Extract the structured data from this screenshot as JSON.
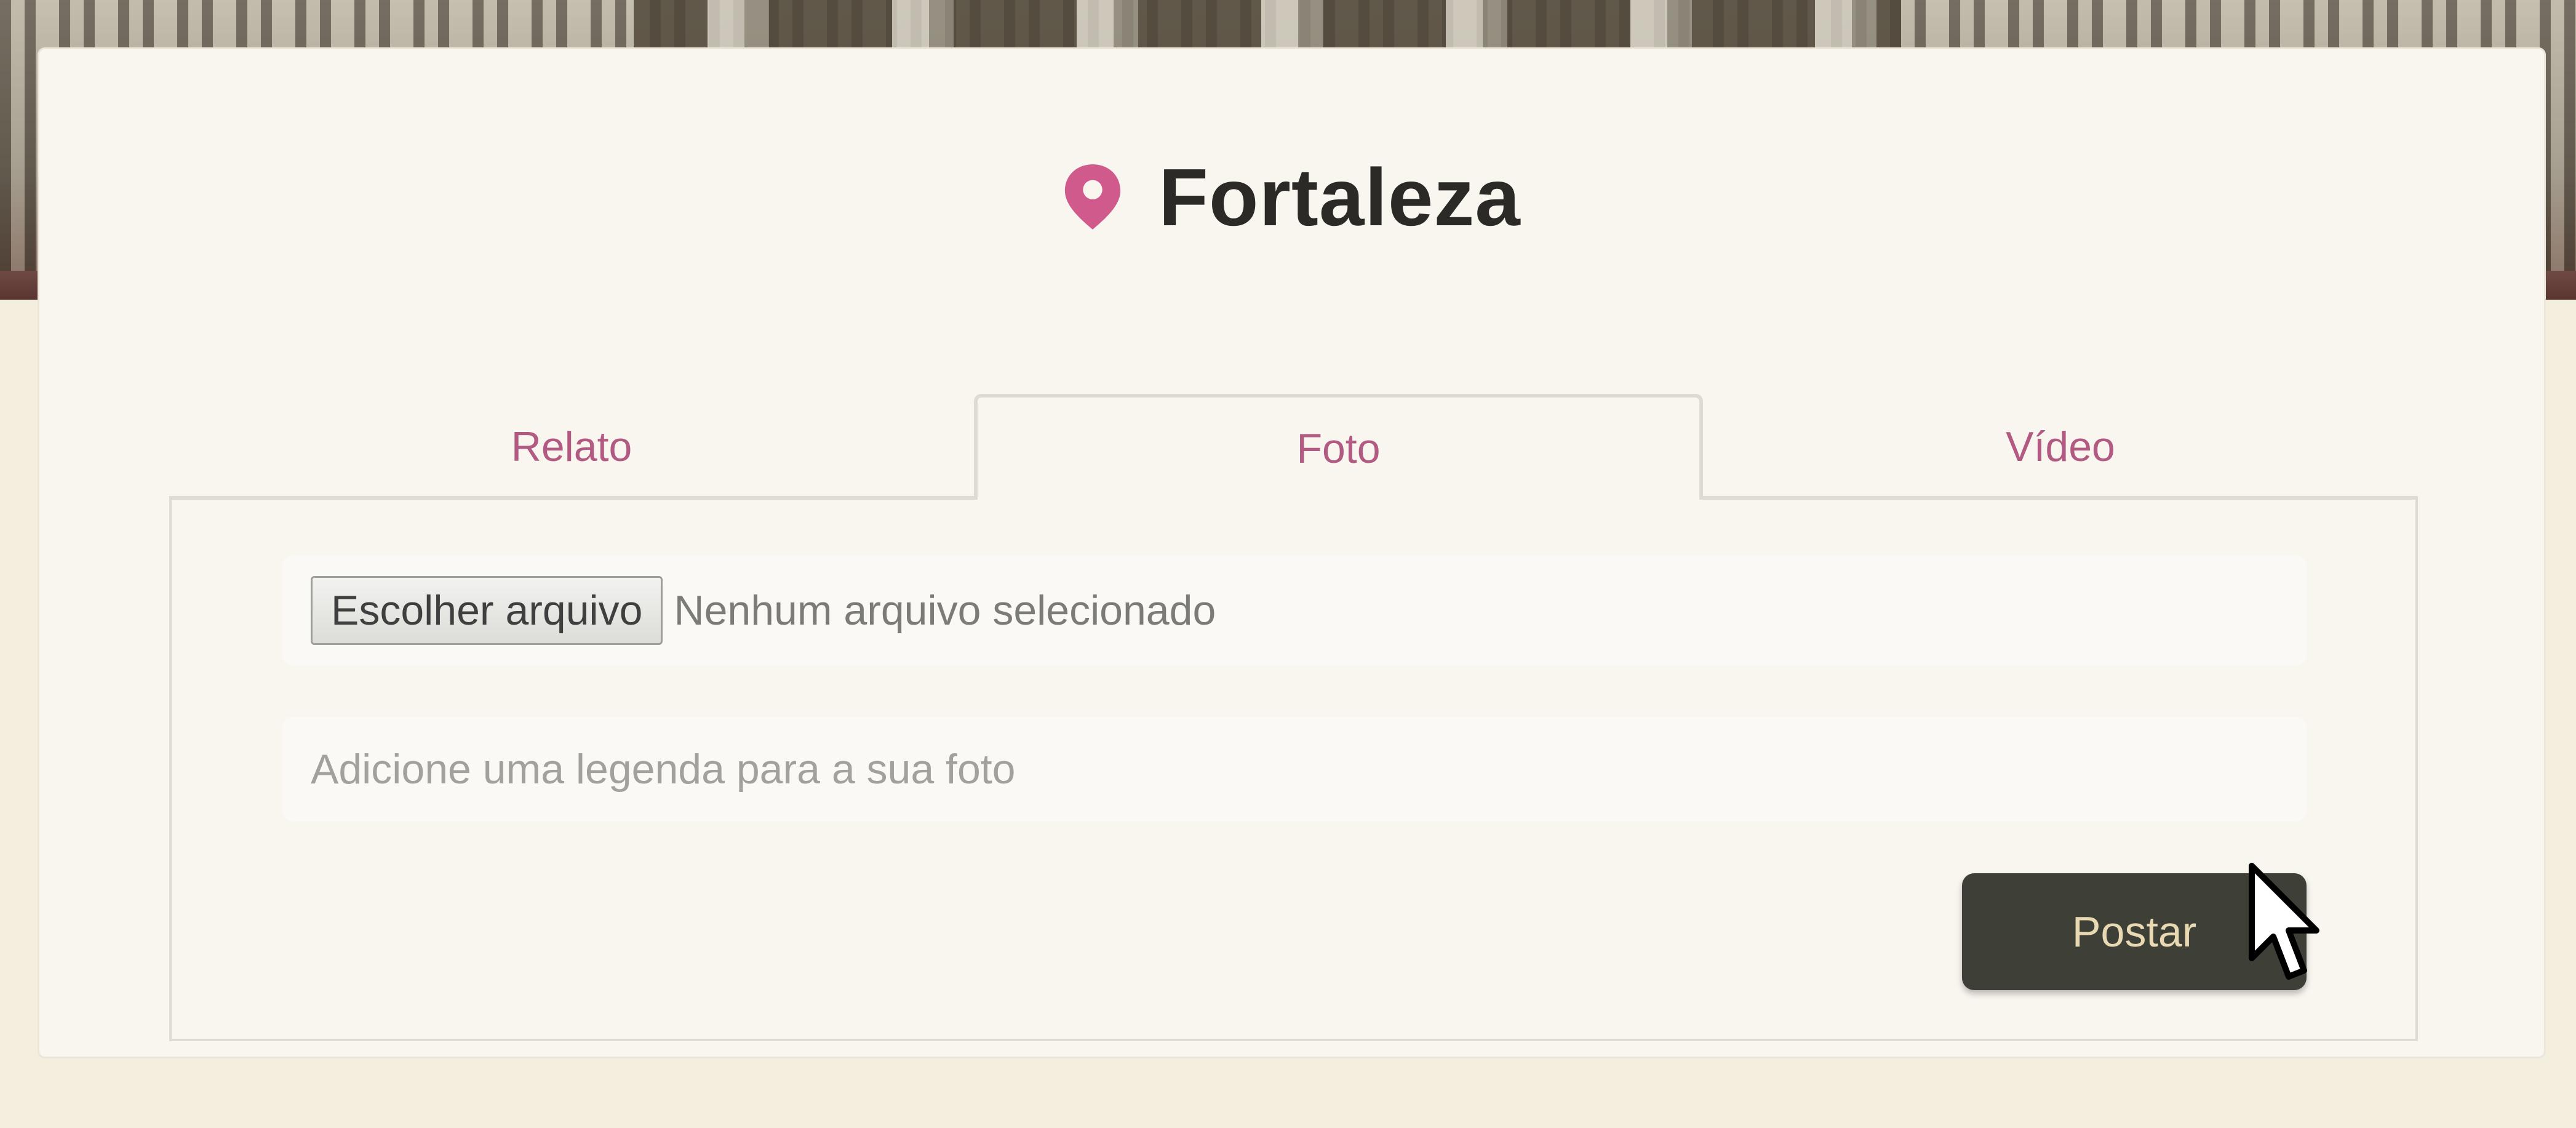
{
  "header": {
    "icon": "map-pin-icon",
    "title": "Fortaleza"
  },
  "tabs": [
    {
      "label": "Relato",
      "active": false
    },
    {
      "label": "Foto",
      "active": true
    },
    {
      "label": "Vídeo",
      "active": false
    }
  ],
  "form": {
    "file_button_label": "Escolher arquivo",
    "file_status": "Nenhum arquivo selecionado",
    "caption_placeholder": "Adicione uma legenda para a sua foto",
    "caption_value": "",
    "submit_label": "Postar"
  },
  "colors": {
    "accent": "#b25a82",
    "pin": "#d15a8c",
    "title": "#2c2a27",
    "button_bg": "#3e4038",
    "button_text": "#e9d9b3",
    "page_bg": "#f4eedf",
    "card_bg": "#f9f5ef"
  }
}
